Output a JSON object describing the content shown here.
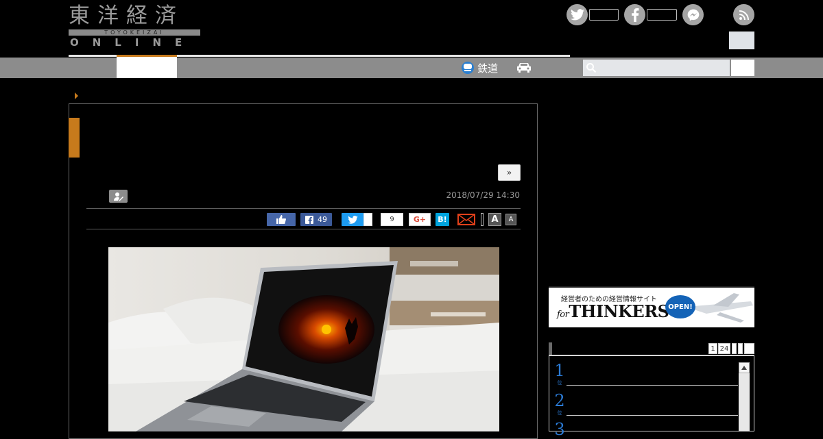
{
  "logo": {
    "kanji": "東洋経済",
    "sub": "TOYOKEIZAI",
    "online": "ONLINE"
  },
  "nav": {
    "rail_label": "鉄道",
    "search_placeholder": ""
  },
  "article": {
    "date": "2018/07/29 14:30",
    "next_label": "»"
  },
  "share": {
    "facebook_count": "49",
    "pocket_count": "9",
    "gplus_label": "G+",
    "hatena_label": "B!",
    "font_large": "A",
    "font_small": "A"
  },
  "banner": {
    "top_text": "経営者のための経営情報サイト",
    "logo_text": "THINKERS",
    "logo_prefix": "for",
    "open_label": "OPEN!"
  },
  "ranking": {
    "tabs": [
      "1",
      "24"
    ],
    "ranks": [
      "1",
      "2",
      "3"
    ],
    "rank_unit": "位"
  },
  "colors": {
    "accent_orange": "#c77a1c",
    "nav_gray": "#8c8c8c",
    "facebook_blue": "#3b5998",
    "twitter_blue": "#1d9bf0",
    "hatena_blue": "#00a4de",
    "rank_blue": "#2b7bd6"
  },
  "icons": {
    "twitter": "twitter-icon",
    "facebook": "facebook-icon",
    "messenger": "messenger-icon",
    "rss": "rss-icon",
    "search": "search-icon",
    "train": "train-icon",
    "car": "car-icon",
    "author": "author-icon",
    "like": "thumbs-up-icon",
    "mail": "mail-icon"
  }
}
